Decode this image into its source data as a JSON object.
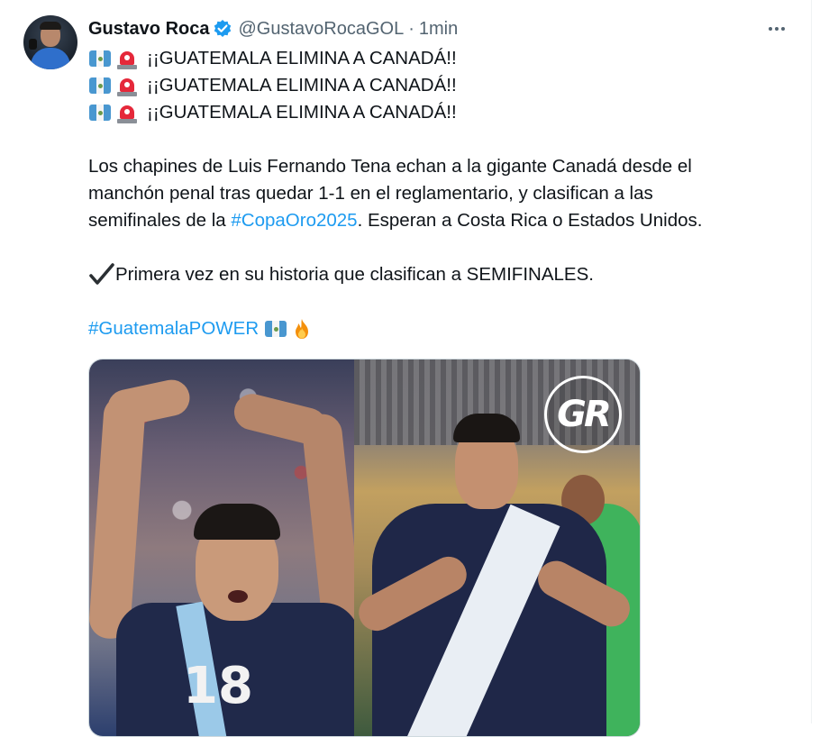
{
  "tweet": {
    "author_name": "Gustavo Roca",
    "handle": "@GustavoRocaGOL",
    "separator": "·",
    "time": "1min",
    "headline_text": "¡¡GUATEMALA ELIMINA A CANADÁ!!",
    "paragraph_lines": [
      "Los chapines de Luis Fernando Tena echan a la gigante Canadá desde el",
      "manchón penal tras quedar 1-1 en el reglamentario, y clasifican a las"
    ],
    "paragraph_line3_before": "semifinales de la ",
    "paragraph_hashtag": "#CopaOro2025",
    "paragraph_line3_after": ". Esperan a Costa Rica o Estados Unidos.",
    "milestone_text": "Primera vez en su historia que clasifican a SEMIFINALES.",
    "closing_hashtag": "#GuatemalaPOWER"
  },
  "media": {
    "logo_text": "GR",
    "left_jersey_number": "18"
  },
  "icons": {
    "verified": "verified-badge-icon",
    "more": "more-options-icon",
    "flag": "guatemala-flag-icon",
    "siren": "police-siren-icon",
    "check": "check-mark-icon",
    "fire": "fire-icon"
  },
  "colors": {
    "link": "#1d9bf0",
    "verified": "#1d9bf0",
    "secondary_text": "#536471"
  }
}
